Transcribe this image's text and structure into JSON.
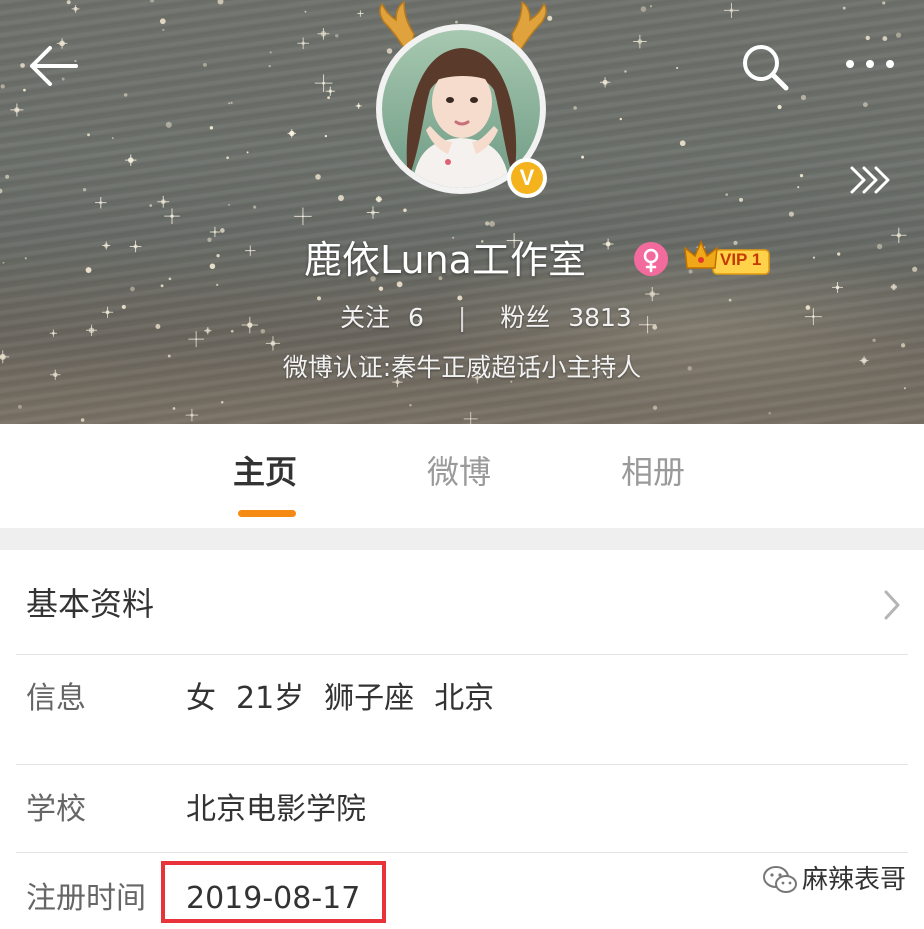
{
  "header": {
    "name": "鹿依Luna工作室",
    "verify_badge_letter": "V",
    "vip_label": "VIP 1",
    "stats": {
      "following_label": "关注",
      "following_count": "6",
      "separator": "|",
      "followers_label": "粉丝",
      "followers_count": "3813"
    },
    "verification": "微博认证:秦牛正威超话小主持人"
  },
  "icons": {
    "back": "arrow-left-icon",
    "search": "search-icon",
    "more": "more-horizontal-icon",
    "forward": "triple-chevron-right-icon",
    "gender": "female-icon",
    "vip": "crown-icon"
  },
  "tabs": [
    {
      "label": "主页",
      "active": true
    },
    {
      "label": "微博",
      "active": false
    },
    {
      "label": "相册",
      "active": false
    }
  ],
  "profile": {
    "section_title": "基本资料",
    "rows": {
      "info": {
        "label": "信息",
        "values": [
          "女",
          "21岁",
          "狮子座",
          "北京"
        ]
      },
      "school": {
        "label": "学校",
        "value": "北京电影学院"
      },
      "registered": {
        "label": "注册时间",
        "value": "2019-08-17"
      }
    }
  },
  "watermark": {
    "text": "麻辣表哥"
  },
  "colors": {
    "accent_orange": "#f58a14",
    "verify_gold": "#f4b31d",
    "highlight_red": "#e8333a",
    "female_pink": "#f26b9c"
  }
}
